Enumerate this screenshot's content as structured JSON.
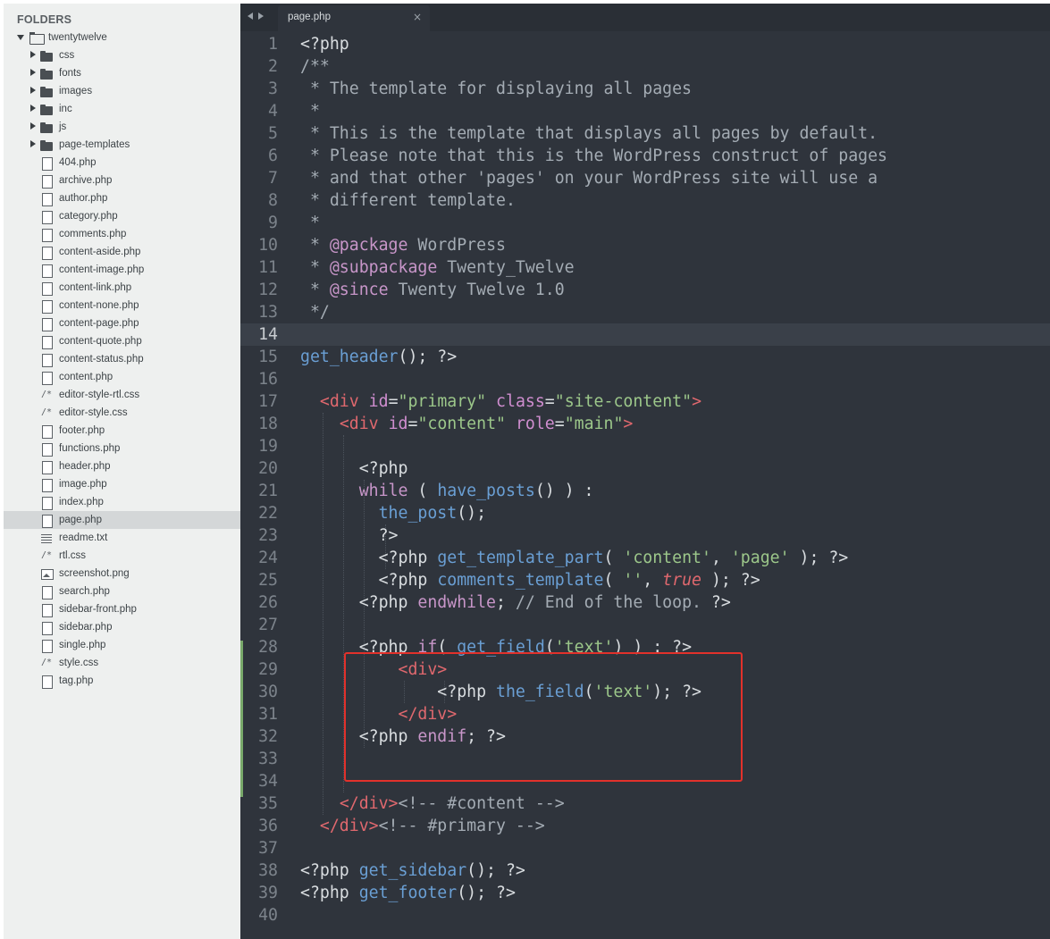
{
  "sidebar": {
    "heading": "FOLDERS",
    "root": "twentytwelve",
    "items": [
      {
        "name": "css",
        "type": "folder"
      },
      {
        "name": "fonts",
        "type": "folder"
      },
      {
        "name": "images",
        "type": "folder"
      },
      {
        "name": "inc",
        "type": "folder"
      },
      {
        "name": "js",
        "type": "folder"
      },
      {
        "name": "page-templates",
        "type": "folder"
      },
      {
        "name": "404.php",
        "type": "file"
      },
      {
        "name": "archive.php",
        "type": "file"
      },
      {
        "name": "author.php",
        "type": "file"
      },
      {
        "name": "category.php",
        "type": "file"
      },
      {
        "name": "comments.php",
        "type": "file"
      },
      {
        "name": "content-aside.php",
        "type": "file"
      },
      {
        "name": "content-image.php",
        "type": "file"
      },
      {
        "name": "content-link.php",
        "type": "file"
      },
      {
        "name": "content-none.php",
        "type": "file"
      },
      {
        "name": "content-page.php",
        "type": "file"
      },
      {
        "name": "content-quote.php",
        "type": "file"
      },
      {
        "name": "content-status.php",
        "type": "file"
      },
      {
        "name": "content.php",
        "type": "file"
      },
      {
        "name": "editor-style-rtl.css",
        "type": "css"
      },
      {
        "name": "editor-style.css",
        "type": "css"
      },
      {
        "name": "footer.php",
        "type": "file"
      },
      {
        "name": "functions.php",
        "type": "file"
      },
      {
        "name": "header.php",
        "type": "file"
      },
      {
        "name": "image.php",
        "type": "file"
      },
      {
        "name": "index.php",
        "type": "file"
      },
      {
        "name": "page.php",
        "type": "file",
        "selected": true
      },
      {
        "name": "readme.txt",
        "type": "txt"
      },
      {
        "name": "rtl.css",
        "type": "css"
      },
      {
        "name": "screenshot.png",
        "type": "image"
      },
      {
        "name": "search.php",
        "type": "file"
      },
      {
        "name": "sidebar-front.php",
        "type": "file"
      },
      {
        "name": "sidebar.php",
        "type": "file"
      },
      {
        "name": "single.php",
        "type": "file"
      },
      {
        "name": "style.css",
        "type": "css"
      },
      {
        "name": "tag.php",
        "type": "file"
      }
    ]
  },
  "tab": {
    "title": "page.php",
    "close": "×"
  },
  "editor": {
    "current_line": 14,
    "colors": {
      "background": "#2f343c",
      "highlight_box": "#e2312b",
      "modified_bar": "#78a86a"
    },
    "lines": [
      [
        [
          "pl",
          "<?php"
        ]
      ],
      [
        [
          "cm",
          "/**"
        ]
      ],
      [
        [
          "cm",
          " * The template for displaying all pages"
        ]
      ],
      [
        [
          "cm",
          " *"
        ]
      ],
      [
        [
          "cm",
          " * This is the template that displays all pages by default."
        ]
      ],
      [
        [
          "cm",
          " * Please note that this is the WordPress construct of pages"
        ]
      ],
      [
        [
          "cm",
          " * and that other 'pages' on your WordPress site will use a"
        ]
      ],
      [
        [
          "cm",
          " * different template."
        ]
      ],
      [
        [
          "cm",
          " *"
        ]
      ],
      [
        [
          "cm",
          " * "
        ],
        [
          "kw",
          "@package"
        ],
        [
          "cm",
          " WordPress"
        ]
      ],
      [
        [
          "cm",
          " * "
        ],
        [
          "kw",
          "@subpackage"
        ],
        [
          "cm",
          " Twenty_Twelve"
        ]
      ],
      [
        [
          "cm",
          " * "
        ],
        [
          "kw",
          "@since"
        ],
        [
          "cm",
          " Twenty Twelve 1.0"
        ]
      ],
      [
        [
          "cm",
          " */"
        ]
      ],
      [],
      [
        [
          "fn",
          "get_header"
        ],
        [
          "pl",
          "(); ?>"
        ]
      ],
      [],
      [
        [
          "pl",
          "  "
        ],
        [
          "tag",
          "<div"
        ],
        [
          "pl",
          " "
        ],
        [
          "attr",
          "id"
        ],
        [
          "pl",
          "="
        ],
        [
          "str",
          "\"primary\""
        ],
        [
          "pl",
          " "
        ],
        [
          "attr",
          "class"
        ],
        [
          "pl",
          "="
        ],
        [
          "str",
          "\"site-content\""
        ],
        [
          "tag",
          ">"
        ]
      ],
      [
        [
          "pl",
          "    "
        ],
        [
          "tag",
          "<div"
        ],
        [
          "pl",
          " "
        ],
        [
          "attr",
          "id"
        ],
        [
          "pl",
          "="
        ],
        [
          "str",
          "\"content\""
        ],
        [
          "pl",
          " "
        ],
        [
          "attr",
          "role"
        ],
        [
          "pl",
          "="
        ],
        [
          "str",
          "\"main\""
        ],
        [
          "tag",
          ">"
        ]
      ],
      [],
      [
        [
          "pl",
          "      <?php"
        ]
      ],
      [
        [
          "pl",
          "      "
        ],
        [
          "kw",
          "while"
        ],
        [
          "pl",
          " ( "
        ],
        [
          "fn",
          "have_posts"
        ],
        [
          "pl",
          "() ) :"
        ]
      ],
      [
        [
          "pl",
          "        "
        ],
        [
          "fn",
          "the_post"
        ],
        [
          "pl",
          "();"
        ]
      ],
      [
        [
          "pl",
          "        ?>"
        ]
      ],
      [
        [
          "pl",
          "        <?php "
        ],
        [
          "fn",
          "get_template_part"
        ],
        [
          "pl",
          "( "
        ],
        [
          "str",
          "'content'"
        ],
        [
          "pl",
          ", "
        ],
        [
          "str",
          "'page'"
        ],
        [
          "pl",
          " ); ?>"
        ]
      ],
      [
        [
          "pl",
          "        <?php "
        ],
        [
          "fn",
          "comments_template"
        ],
        [
          "pl",
          "( "
        ],
        [
          "str",
          "''"
        ],
        [
          "pl",
          ", "
        ],
        [
          "it",
          "true"
        ],
        [
          "pl",
          " ); ?>"
        ]
      ],
      [
        [
          "pl",
          "      <?php "
        ],
        [
          "kw",
          "endwhile"
        ],
        [
          "pl",
          "; "
        ],
        [
          "cm",
          "// End of the loop."
        ],
        [
          "pl",
          " ?>"
        ]
      ],
      [],
      [
        [
          "pl",
          "      <?php "
        ],
        [
          "kw",
          "if"
        ],
        [
          "pl",
          "( "
        ],
        [
          "fn",
          "get_field"
        ],
        [
          "pl",
          "("
        ],
        [
          "str",
          "'text'"
        ],
        [
          "pl",
          ") ) : ?>"
        ]
      ],
      [
        [
          "pl",
          "          "
        ],
        [
          "tag",
          "<div>"
        ]
      ],
      [
        [
          "pl",
          "              <?php "
        ],
        [
          "fn",
          "the_field"
        ],
        [
          "pl",
          "("
        ],
        [
          "str",
          "'text'"
        ],
        [
          "pl",
          "); ?>"
        ]
      ],
      [
        [
          "pl",
          "          "
        ],
        [
          "tag",
          "</div>"
        ]
      ],
      [
        [
          "pl",
          "      <?php "
        ],
        [
          "kw",
          "endif"
        ],
        [
          "pl",
          "; ?>"
        ]
      ],
      [],
      [],
      [
        [
          "pl",
          "    "
        ],
        [
          "tag",
          "</div>"
        ],
        [
          "cm",
          "<!-- #content -->"
        ]
      ],
      [
        [
          "pl",
          "  "
        ],
        [
          "tag",
          "</div>"
        ],
        [
          "cm",
          "<!-- #primary -->"
        ]
      ],
      [],
      [
        [
          "pl",
          "<?php "
        ],
        [
          "fn",
          "get_sidebar"
        ],
        [
          "pl",
          "(); ?>"
        ]
      ],
      [
        [
          "pl",
          "<?php "
        ],
        [
          "fn",
          "get_footer"
        ],
        [
          "pl",
          "(); ?>"
        ]
      ],
      []
    ]
  }
}
